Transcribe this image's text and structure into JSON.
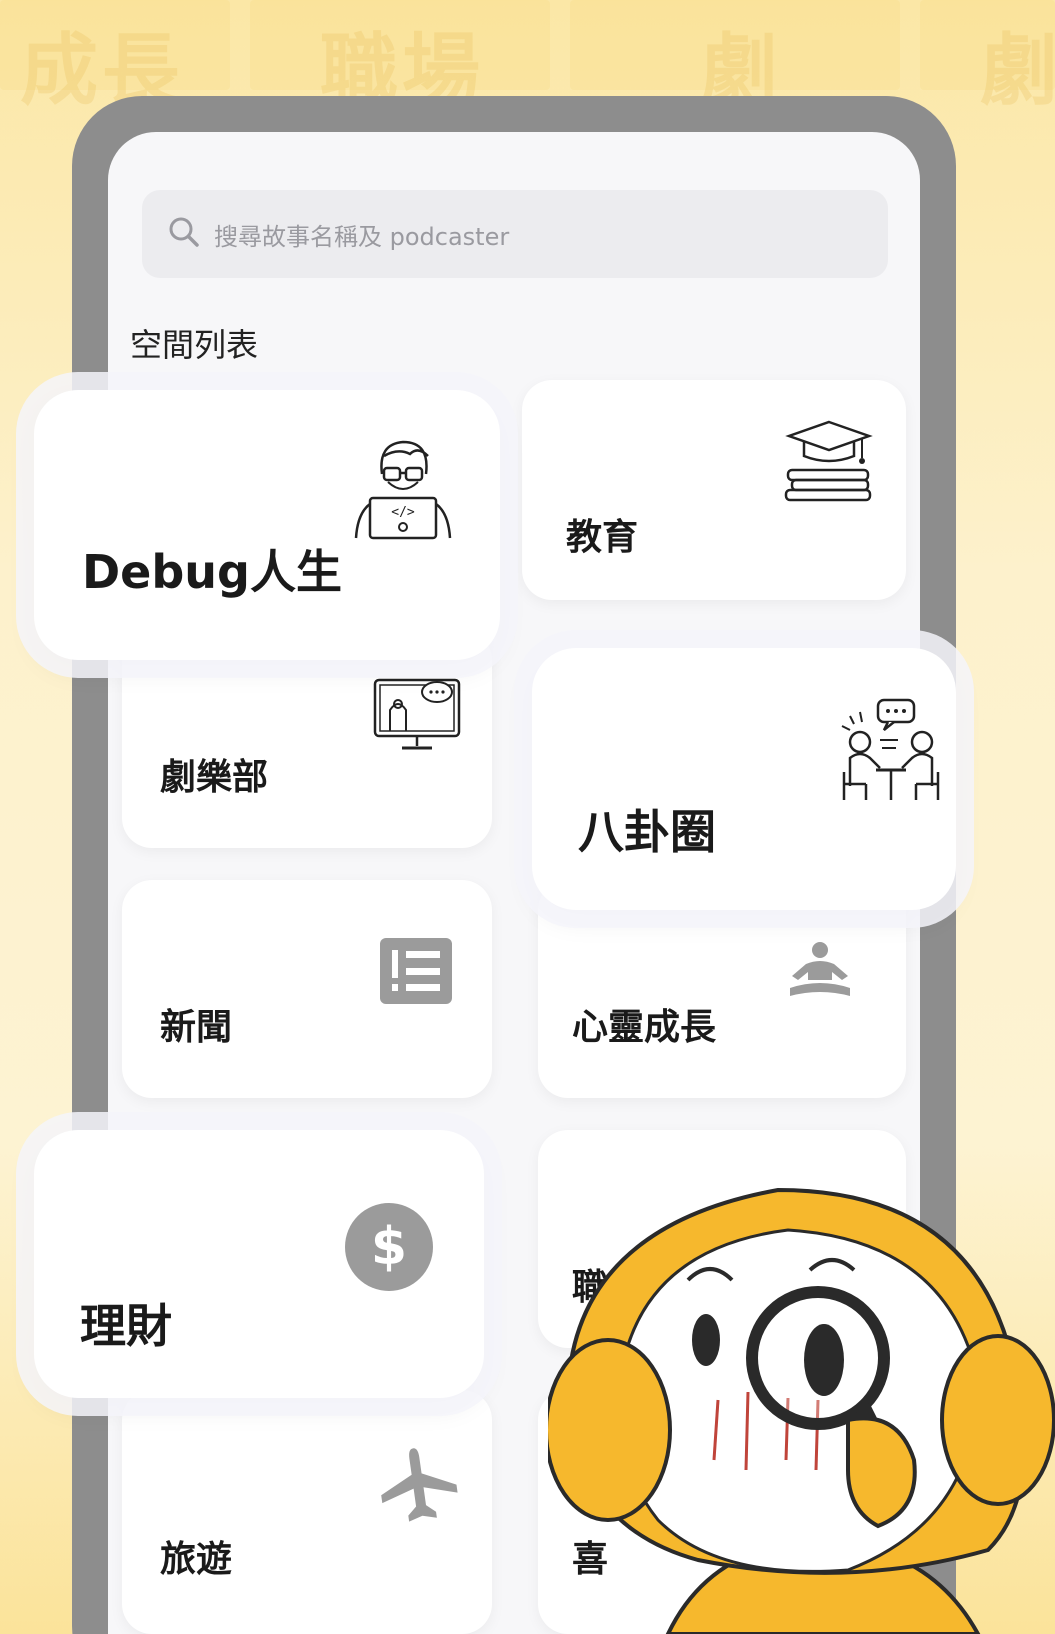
{
  "background_words": [
    "成長",
    "職場",
    "劇",
    "劇"
  ],
  "search": {
    "placeholder": "搜尋故事名稱及 podcaster"
  },
  "section_title": "空間列表",
  "categories": [
    {
      "label": "Debug人生",
      "icon": "programmer-laptop-icon",
      "highlighted": true
    },
    {
      "label": "教育",
      "icon": "graduation-books-icon",
      "highlighted": false
    },
    {
      "label": "劇樂部",
      "icon": "monitor-chat-icon",
      "highlighted": false
    },
    {
      "label": "八卦圈",
      "icon": "people-chatting-icon",
      "highlighted": true
    },
    {
      "label": "新聞",
      "icon": "news-list-icon",
      "highlighted": false
    },
    {
      "label": "心靈成長",
      "icon": "meditation-icon",
      "highlighted": false
    },
    {
      "label": "理財",
      "icon": "dollar-coin-icon",
      "highlighted": true
    },
    {
      "label": "職",
      "icon": "",
      "highlighted": false
    },
    {
      "label": "旅遊",
      "icon": "airplane-icon",
      "highlighted": false
    },
    {
      "label": "喜",
      "icon": "",
      "highlighted": false
    }
  ],
  "colors": {
    "background": "#fdf1cc",
    "phone_frame": "#8d8d8d",
    "card": "#ffffff",
    "icon_gray": "#9b9b9b",
    "mascot_yellow": "#f6b82d"
  }
}
